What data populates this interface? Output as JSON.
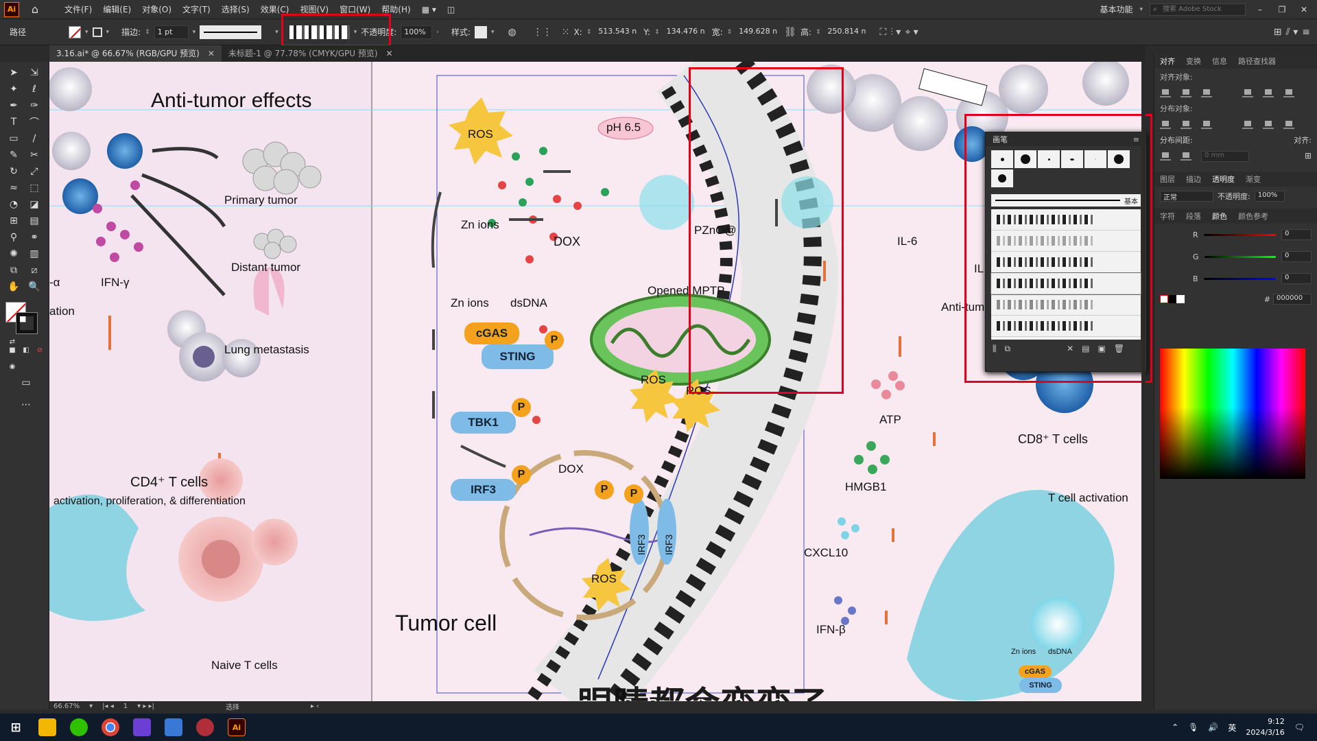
{
  "menubar": {
    "app": "Ai",
    "items": [
      "文件(F)",
      "编辑(E)",
      "对象(O)",
      "文字(T)",
      "选择(S)",
      "效果(C)",
      "视图(V)",
      "窗口(W)",
      "帮助(H)"
    ],
    "workspace": "基本功能",
    "search_placeholder": "搜索 Adobe Stock"
  },
  "controlbar": {
    "label": "路径",
    "stroke_label": "描边:",
    "stroke_weight": "1 pt",
    "stroke_profile": "等比",
    "opacity_label": "不透明度:",
    "opacity": "100%",
    "style_label": "样式:",
    "x_label": "X:",
    "x": "513.543 n",
    "y_label": "Y:",
    "y": "134.476 n",
    "w_label": "宽:",
    "w": "149.628 n",
    "h_label": "高:",
    "h": "250.814 n"
  },
  "tabs": [
    {
      "label": "3.16.ai* @ 66.67% (RGB/GPU 预览)"
    },
    {
      "label": "未标题-1 @ 77.78% (CMYK/GPU 预览)"
    }
  ],
  "status": {
    "zoom": "66.67%",
    "page": "1",
    "mode": "选择"
  },
  "right_panel": {
    "tabs_top": [
      "对齐",
      "变换",
      "信息",
      "路径查找器"
    ],
    "align_objects": "对齐对象:",
    "distribute_objects": "分布对象:",
    "distribute_spacing": "分布间距:",
    "align_to": "对齐:",
    "spacing_value": "0 mm",
    "tabs_mid": [
      "图层",
      "描边",
      "透明度",
      "渐变"
    ],
    "blend_mode": "正常",
    "opacity_label": "不透明度:",
    "opacity": "100%",
    "tabs_color": [
      "字符",
      "段落",
      "颜色",
      "颜色参考"
    ],
    "r_label": "R",
    "r": "0",
    "g_label": "G",
    "g": "0",
    "b_label": "B",
    "b": "0",
    "hex": "000000"
  },
  "brush_panel": {
    "title": "画笔",
    "basic": "基本"
  },
  "figure": {
    "title": "Anti-tumor effects",
    "primary_tumor": "Primary tumor",
    "distant_tumor": "Distant tumor",
    "lung": "Lung metastasis",
    "ifn_gamma": "IFN-γ",
    "alpha": "-α",
    "ation": "ation",
    "cd4": "CD4⁺ T cells",
    "cd4_desc": "activation, proliferation, & differentiation",
    "naive": "Naive T cells",
    "ros1": "ROS",
    "ph": "pH 6.5",
    "dox1": "DOX",
    "pzno": "PZnO@",
    "zn1": "Zn ions",
    "zn2": "Zn ions",
    "dsdna": "dsDNA",
    "cgas": "cGAS",
    "sting": "STING",
    "tbk1": "TBK1",
    "irf3": "IRF3",
    "p": "P",
    "mptp": "Opened MPTP",
    "ros2": "ROS",
    "ros3": "ROS",
    "ros4": "ROS",
    "dox2": "DOX",
    "irf3a": "IRF3",
    "irf3b": "IRF3",
    "tumor_cell": "Tumor cell",
    "il6": "IL-6",
    "il": "IL",
    "anti": "Anti-tum",
    "atp": "ATP",
    "hmgb1": "HMGB1",
    "cxcl10": "CXCL10",
    "ifnb": "IFN-β",
    "cd8": "CD8⁺ T cells",
    "tact": "T cell activation",
    "zn3": "Zn ions",
    "dsdna2": "dsDNA",
    "cgas2": "cGAS",
    "sting2": "STING"
  },
  "subtitle": "眼睛都会变变了",
  "taskbar": {
    "lang": "英",
    "time": "9:12",
    "date": "2024/3/16"
  }
}
